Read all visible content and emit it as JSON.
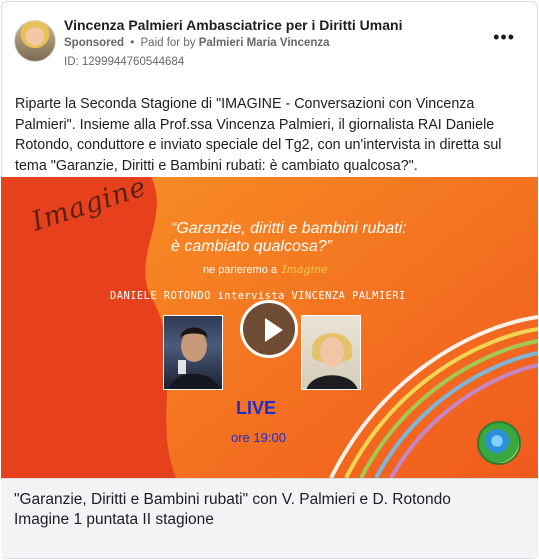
{
  "post": {
    "page_name": "Vincenza Palmieri Ambasciatrice per i Diritti Umani",
    "sponsored_label": "Sponsored",
    "separator": "•",
    "paid_for_prefix": "Paid for by",
    "paid_for_name": "Palmieri Maria Vincenza",
    "ad_id": "ID: 1299944760544684",
    "more_icon": "more-options-icon",
    "more_glyph": "•••",
    "body_text": "Riparte la Seconda Stagione di \"IMAGINE - Conversazioni con Vincenza Palmieri\". Insieme alla Prof.ssa Vincenza Palmieri, il giornalista RAI Daniele Rotondo, conduttore e inviato speciale del Tg2, con un'intervista in diretta sul tema \"Garanzie, Diritti e Bambini rubati: è cambiato qualcosa?\"."
  },
  "media": {
    "brand": "Imagine",
    "quote_line1": "“Garanzie, diritti e bambini rubati:",
    "quote_line2": "è cambiato qualcosa?”",
    "parleremo": "ne parleremo a",
    "parleremo_brand": "Imagine",
    "names": "DANIELE ROTONDO intervista  VINCENZA PALMIERI",
    "live": "LIVE",
    "time": "ore 19:00",
    "play_icon": "play-icon",
    "colors": {
      "bg_red": "#e8401a",
      "bg_orange": "#f47a1f",
      "live_blue": "#1a2fcf"
    }
  },
  "caption": {
    "title": "\"Garanzie, Diritti e Bambini rubati\" con V. Palmieri e D. Rotondo",
    "subtitle": "Imagine 1 puntata II stagione"
  }
}
